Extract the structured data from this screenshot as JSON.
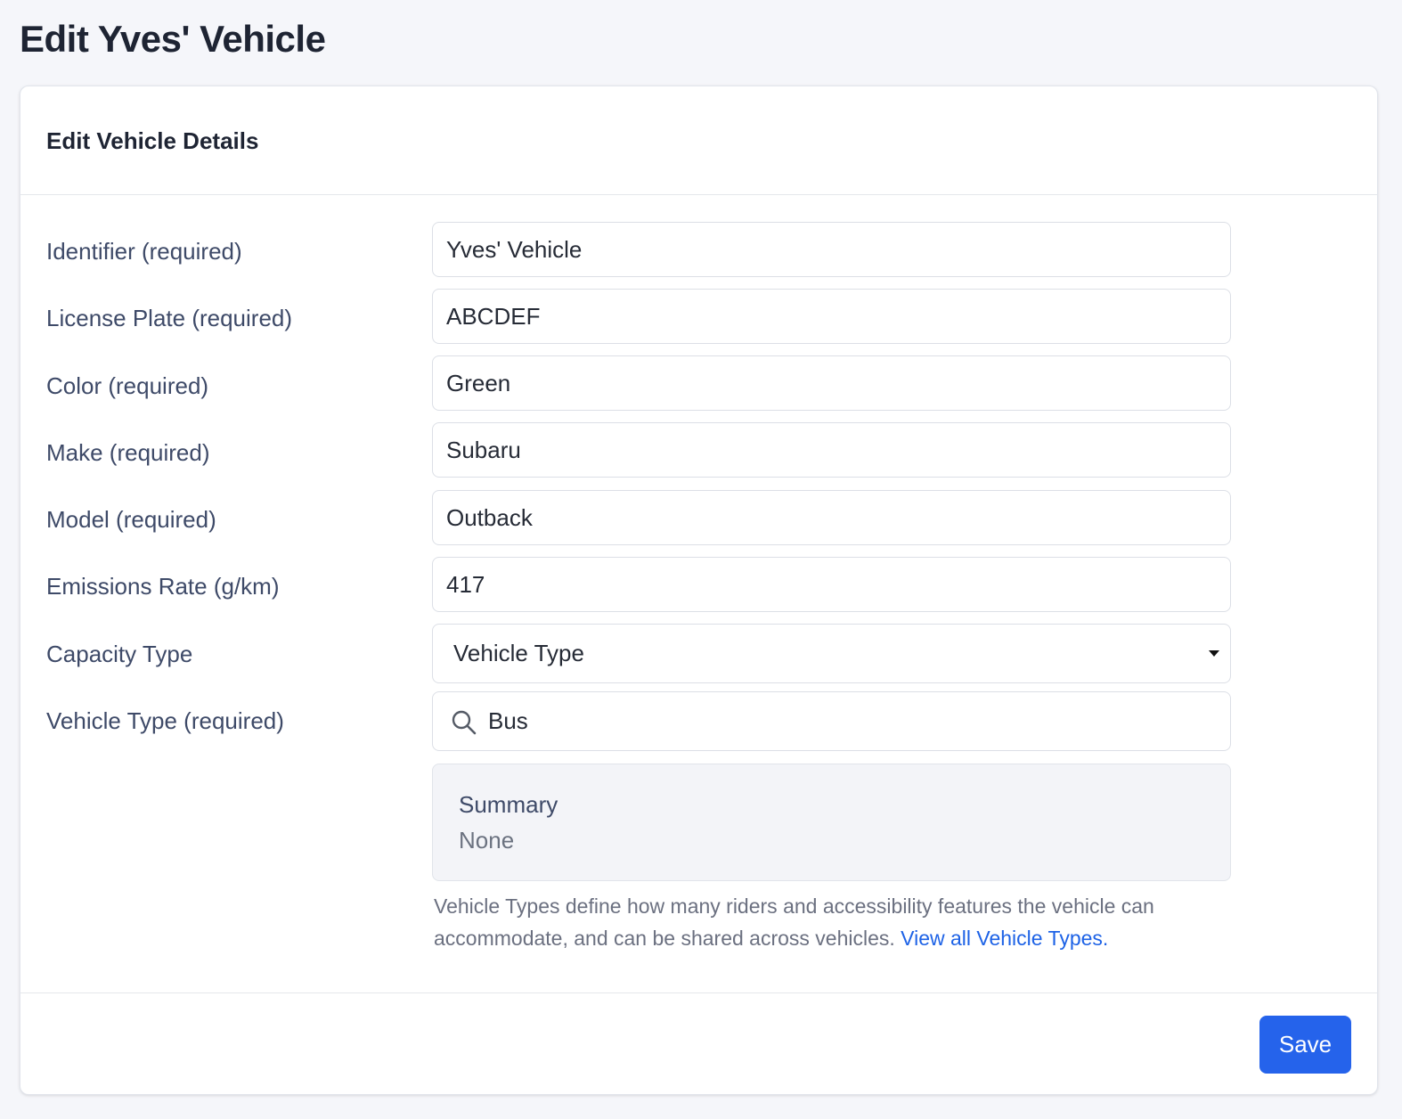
{
  "page": {
    "title": "Edit Yves' Vehicle"
  },
  "card": {
    "title": "Edit Vehicle Details"
  },
  "fields": {
    "identifier": {
      "label": "Identifier (required)",
      "value": "Yves' Vehicle"
    },
    "license_plate": {
      "label": "License Plate (required)",
      "value": "ABCDEF"
    },
    "color": {
      "label": "Color (required)",
      "value": "Green"
    },
    "make": {
      "label": "Make (required)",
      "value": "Subaru"
    },
    "model": {
      "label": "Model (required)",
      "value": "Outback"
    },
    "emissions_rate": {
      "label": "Emissions Rate (g/km)",
      "value": "417"
    },
    "capacity_type": {
      "label": "Capacity Type",
      "selected": "Vehicle Type"
    },
    "vehicle_type": {
      "label": "Vehicle Type (required)",
      "value": "Bus"
    }
  },
  "summary": {
    "title": "Summary",
    "value": "None"
  },
  "help": {
    "text": "Vehicle Types define how many riders and accessibility features the vehicle can accommodate, and can be shared across vehicles.",
    "link_text": "View all Vehicle Types."
  },
  "footer": {
    "save_label": "Save"
  },
  "icons": {
    "search": "search-icon",
    "caret": "chevron-down-icon"
  },
  "colors": {
    "primary": "#2563eb",
    "link": "#1d62e6",
    "background": "#f5f6fa"
  }
}
